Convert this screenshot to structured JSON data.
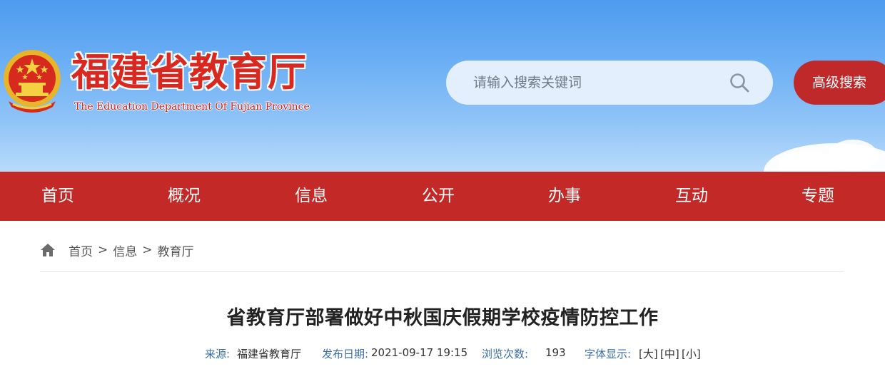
{
  "header": {
    "site_name": "福建省教育厅",
    "site_name_en": "The Education Department Of Fujian Province",
    "search_placeholder": "请输入搜索关键词",
    "advanced_search_label": "高级搜索"
  },
  "nav": {
    "items": [
      {
        "label": "首页"
      },
      {
        "label": "概况"
      },
      {
        "label": "信息"
      },
      {
        "label": "公开"
      },
      {
        "label": "办事"
      },
      {
        "label": "互动"
      },
      {
        "label": "专题"
      }
    ]
  },
  "breadcrumb": {
    "items": [
      "首页",
      "信息",
      "教育厅"
    ],
    "separator": ">"
  },
  "article": {
    "title": "省教育厅部署做好中秋国庆假期学校疫情防控工作",
    "source_label": "来源:",
    "source_value": "福建省教育厅",
    "date_label": "发布日期:",
    "date_value": "2021-09-17 19:15",
    "views_label": "浏览次数:",
    "views_value": "193",
    "font_label": "字体显示:",
    "font_large": "[大]",
    "font_medium": "[中]",
    "font_small": "[小]"
  },
  "colors": {
    "nav_red": "#c32a27",
    "button_red": "#c0292a",
    "title_red": "#d8281f",
    "banner_blue": "#4f9bf0",
    "meta_label_blue": "#3a6ea5"
  },
  "icons": {
    "emblem": "national-emblem-icon",
    "search": "search-icon",
    "home": "home-icon"
  }
}
